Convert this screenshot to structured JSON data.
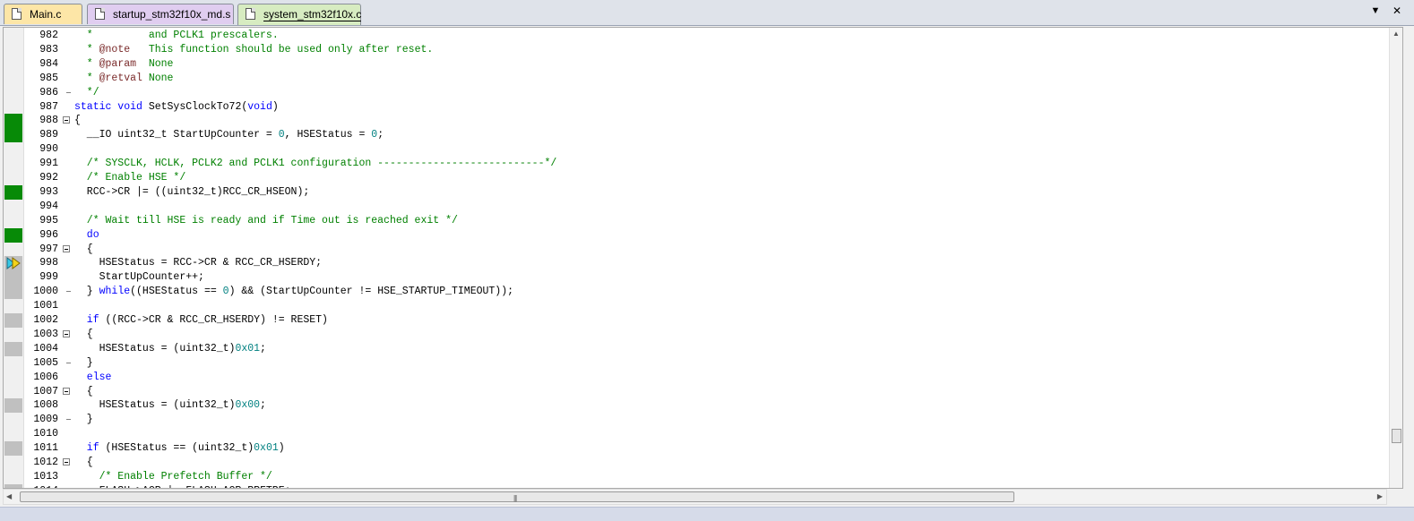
{
  "tabs": [
    {
      "label": "Main.c",
      "active": false
    },
    {
      "label": "startup_stm32f10x_md.s",
      "active": false
    },
    {
      "label": "system_stm32f10x.c",
      "active": true
    }
  ],
  "tab_menu_icon": "dropdown-arrow-icon",
  "tab_close_icon": "close-icon",
  "colors": {
    "comment": "#008000",
    "keyword": "#0000ff",
    "number": "#008080",
    "coverage_executed": "#078a07",
    "coverage_not_executed": "#c0c0c0",
    "tab_main": "#fde6a7",
    "tab_startup": "#e0cdf0",
    "tab_system": "#d7ecc1"
  },
  "current_line_icon": "execution-arrow-icon",
  "lines": [
    {
      "n": "982",
      "mark": "",
      "fold": "",
      "segs": [
        [
          "c",
          "  *         and PCLK1 prescalers."
        ]
      ]
    },
    {
      "n": "983",
      "mark": "",
      "fold": "",
      "segs": [
        [
          "c",
          "  * "
        ],
        [
          "d",
          "@note"
        ],
        [
          "c",
          "   This function should be used only after reset."
        ]
      ]
    },
    {
      "n": "984",
      "mark": "",
      "fold": "",
      "segs": [
        [
          "c",
          "  * "
        ],
        [
          "d",
          "@param"
        ],
        [
          "c",
          "  None"
        ]
      ]
    },
    {
      "n": "985",
      "mark": "",
      "fold": "",
      "segs": [
        [
          "c",
          "  * "
        ],
        [
          "d",
          "@retval"
        ],
        [
          "c",
          " None"
        ]
      ]
    },
    {
      "n": "986",
      "mark": "",
      "fold": "end",
      "segs": [
        [
          "c",
          "  */"
        ]
      ]
    },
    {
      "n": "987",
      "mark": "",
      "fold": "",
      "segs": [
        [
          "k",
          "static void"
        ],
        [
          "t",
          " SetSysClockTo72("
        ],
        [
          "k",
          "void"
        ],
        [
          "t",
          ")"
        ]
      ]
    },
    {
      "n": "988",
      "mark": "green",
      "fold": "open",
      "segs": [
        [
          "t",
          "{"
        ]
      ]
    },
    {
      "n": "989",
      "mark": "green",
      "fold": "",
      "segs": [
        [
          "t",
          "  __IO uint32_t StartUpCounter = "
        ],
        [
          "n",
          "0"
        ],
        [
          "t",
          ", HSEStatus = "
        ],
        [
          "n",
          "0"
        ],
        [
          "t",
          ";"
        ]
      ]
    },
    {
      "n": "990",
      "mark": "",
      "fold": "",
      "segs": []
    },
    {
      "n": "991",
      "mark": "",
      "fold": "",
      "segs": [
        [
          "c",
          "  /* SYSCLK, HCLK, PCLK2 and PCLK1 configuration ---------------------------*/"
        ]
      ]
    },
    {
      "n": "992",
      "mark": "",
      "fold": "",
      "segs": [
        [
          "c",
          "  /* Enable HSE */"
        ]
      ]
    },
    {
      "n": "993",
      "mark": "green",
      "fold": "",
      "segs": [
        [
          "t",
          "  RCC->CR |= ((uint32_t)RCC_CR_HSEON);"
        ]
      ]
    },
    {
      "n": "994",
      "mark": "",
      "fold": "",
      "segs": []
    },
    {
      "n": "995",
      "mark": "",
      "fold": "",
      "segs": [
        [
          "c",
          "  /* Wait till HSE is ready and if Time out is reached exit */"
        ]
      ]
    },
    {
      "n": "996",
      "mark": "green",
      "fold": "",
      "segs": [
        [
          "k",
          "  do"
        ]
      ]
    },
    {
      "n": "997",
      "mark": "",
      "fold": "open",
      "segs": [
        [
          "t",
          "  {"
        ]
      ]
    },
    {
      "n": "998",
      "mark": "arrow",
      "fold": "",
      "segs": [
        [
          "t",
          "    HSEStatus = RCC->CR & RCC_CR_HSERDY;"
        ]
      ]
    },
    {
      "n": "999",
      "mark": "gray",
      "fold": "",
      "segs": [
        [
          "t",
          "    StartUpCounter++;"
        ]
      ]
    },
    {
      "n": "1000",
      "mark": "gray",
      "fold": "end",
      "segs": [
        [
          "t",
          "  } "
        ],
        [
          "k",
          "while"
        ],
        [
          "t",
          "((HSEStatus == "
        ],
        [
          "n",
          "0"
        ],
        [
          "t",
          ") && (StartUpCounter != HSE_STARTUP_TIMEOUT));"
        ]
      ]
    },
    {
      "n": "1001",
      "mark": "",
      "fold": "",
      "segs": []
    },
    {
      "n": "1002",
      "mark": "gray",
      "fold": "",
      "segs": [
        [
          "k",
          "  if"
        ],
        [
          "t",
          " ((RCC->CR & RCC_CR_HSERDY) != RESET)"
        ]
      ]
    },
    {
      "n": "1003",
      "mark": "",
      "fold": "open",
      "segs": [
        [
          "t",
          "  {"
        ]
      ]
    },
    {
      "n": "1004",
      "mark": "gray",
      "fold": "",
      "segs": [
        [
          "t",
          "    HSEStatus = (uint32_t)"
        ],
        [
          "n",
          "0x01"
        ],
        [
          "t",
          ";"
        ]
      ]
    },
    {
      "n": "1005",
      "mark": "",
      "fold": "end",
      "segs": [
        [
          "t",
          "  }"
        ]
      ]
    },
    {
      "n": "1006",
      "mark": "",
      "fold": "",
      "segs": [
        [
          "k",
          "  else"
        ]
      ]
    },
    {
      "n": "1007",
      "mark": "",
      "fold": "open",
      "segs": [
        [
          "t",
          "  {"
        ]
      ]
    },
    {
      "n": "1008",
      "mark": "gray",
      "fold": "",
      "segs": [
        [
          "t",
          "    HSEStatus = (uint32_t)"
        ],
        [
          "n",
          "0x00"
        ],
        [
          "t",
          ";"
        ]
      ]
    },
    {
      "n": "1009",
      "mark": "",
      "fold": "end",
      "segs": [
        [
          "t",
          "  }"
        ]
      ]
    },
    {
      "n": "1010",
      "mark": "",
      "fold": "",
      "segs": []
    },
    {
      "n": "1011",
      "mark": "gray",
      "fold": "",
      "segs": [
        [
          "k",
          "  if"
        ],
        [
          "t",
          " (HSEStatus == (uint32_t)"
        ],
        [
          "n",
          "0x01"
        ],
        [
          "t",
          ")"
        ]
      ]
    },
    {
      "n": "1012",
      "mark": "",
      "fold": "open",
      "segs": [
        [
          "t",
          "  {"
        ]
      ]
    },
    {
      "n": "1013",
      "mark": "",
      "fold": "",
      "segs": [
        [
          "c",
          "    /* Enable Prefetch Buffer */"
        ]
      ]
    },
    {
      "n": "1014",
      "mark": "gray",
      "fold": "",
      "segs": [
        [
          "t",
          "    FLASH->ACR |= FLASH_ACR_PRFTBE;"
        ]
      ]
    }
  ]
}
